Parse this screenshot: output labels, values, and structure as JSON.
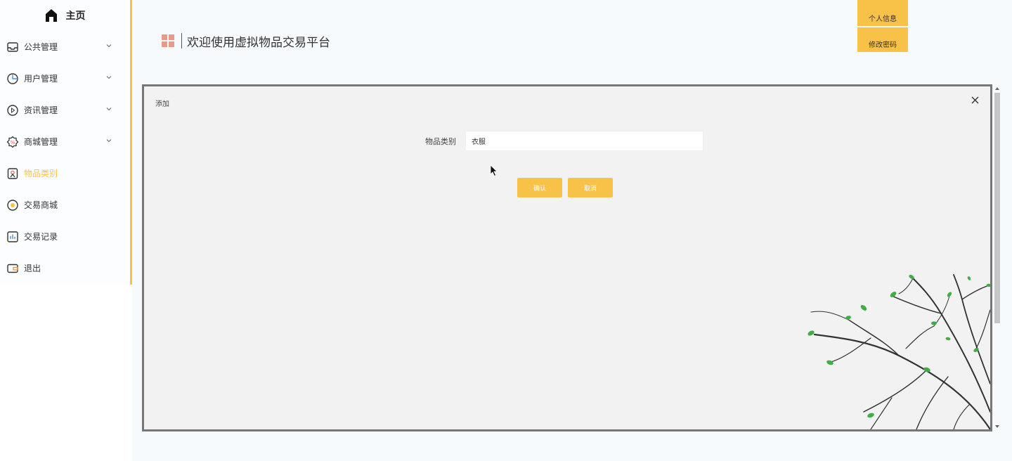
{
  "sidebar": {
    "home_label": "主页",
    "items": [
      {
        "label": "公共管理",
        "icon": "inbox-icon",
        "has_chevron": true,
        "active": false
      },
      {
        "label": "用户管理",
        "icon": "pie-chart-icon",
        "has_chevron": true,
        "active": false
      },
      {
        "label": "资讯管理",
        "icon": "play-circle-icon",
        "has_chevron": true,
        "active": false
      },
      {
        "label": "商城管理",
        "icon": "coupon-icon",
        "has_chevron": true,
        "active": false
      },
      {
        "label": "物品类别",
        "icon": "badge-icon",
        "has_chevron": false,
        "active": true
      },
      {
        "label": "交易商城",
        "icon": "star-circle-icon",
        "has_chevron": false,
        "active": false
      },
      {
        "label": "交易记录",
        "icon": "bar-chart-icon",
        "has_chevron": false,
        "active": false
      },
      {
        "label": "退出",
        "icon": "wallet-icon",
        "has_chevron": false,
        "active": false
      }
    ]
  },
  "header": {
    "title": "欢迎使用虚拟物品交易平台",
    "profile_label": "个人信息",
    "password_label": "修改密码"
  },
  "dialog": {
    "title": "添加",
    "field_label": "物品类别",
    "field_value": "衣服",
    "confirm_label": "确认",
    "cancel_label": "取消"
  },
  "colors": {
    "accent": "#f7c247",
    "active_text": "#f7c247",
    "dialog_bg": "#f2f2f2",
    "title_icon": "#e79a8a"
  }
}
